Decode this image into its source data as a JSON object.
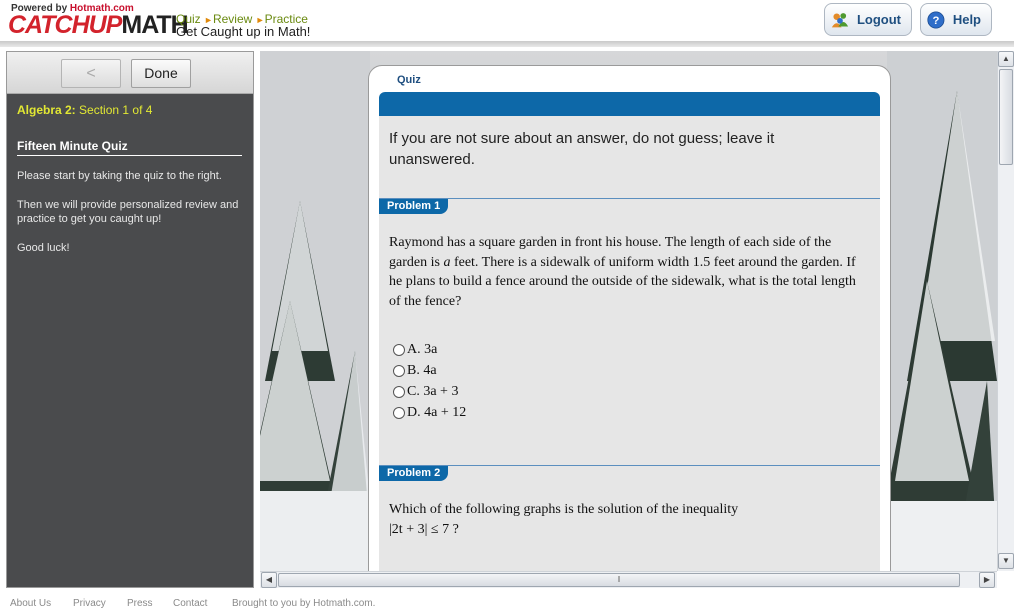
{
  "header": {
    "powered_prefix": "Powered by ",
    "powered_brand": "Hotmath.com",
    "logo_catchup": "CATCHUP",
    "logo_math": "MATH",
    "steps": [
      "Quiz",
      "Review",
      "Practice"
    ],
    "tagline": "Get Caught up in Math!",
    "logout_label": "Logout",
    "help_label": "Help"
  },
  "sidebar": {
    "back_label": "<",
    "done_label": "Done",
    "course": "Algebra 2:",
    "section": "Section 1 of 4",
    "title": "Fifteen Minute Quiz",
    "paragraphs": [
      "Please start by taking the quiz to the right.",
      "Then we will provide personalized review and practice to get you caught up!",
      "Good luck!"
    ]
  },
  "quiz": {
    "tab_label": "Quiz",
    "instructions": "If you are not sure about an answer, do not guess; leave it unanswered.",
    "problems": [
      {
        "label": "Problem 1",
        "text_a": "Raymond has a square garden in front his house. The length of each side of the garden is ",
        "text_var": "a",
        "text_b": " feet. There is a sidewalk of uniform width 1.5 feet around the garden. If he plans to build a fence around the outside of the sidewalk, what is the total length of the fence?",
        "choices": [
          "A. 3a",
          "B. 4a",
          "C. 3a + 3",
          "D. 4a + 12"
        ]
      },
      {
        "label": "Problem 2",
        "text": "Which of the following graphs is the solution of the inequality",
        "inequality": "|2t + 3| ≤ 7 ?"
      }
    ]
  },
  "footer": {
    "links": [
      "About Us",
      "Privacy",
      "Press",
      "Contact"
    ],
    "credit": "Brought to you by Hotmath.com."
  }
}
